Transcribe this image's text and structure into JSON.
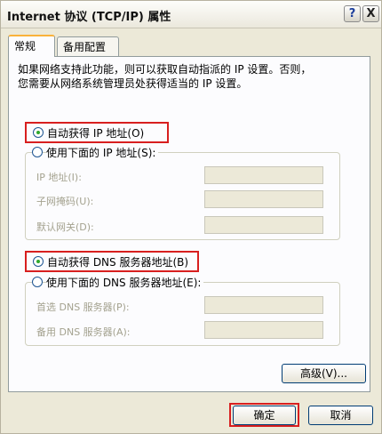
{
  "window": {
    "title": "Internet 协议 (TCP/IP) 属性",
    "help_label": "?",
    "close_label": "X"
  },
  "tabs": [
    {
      "label": "常规",
      "active": true
    },
    {
      "label": "备用配置",
      "active": false
    }
  ],
  "description_lines": [
    "如果网络支持此功能，则可以获取自动指派的 IP 设置。否则，",
    "您需要从网络系统管理员处获得适当的 IP 设置。"
  ],
  "ip": {
    "auto_label": "自动获得 IP 地址(O)",
    "manual_label": "使用下面的 IP 地址(S):",
    "selected": "auto",
    "fields": [
      {
        "label": "IP 地址(I):",
        "value": ""
      },
      {
        "label": "子网掩码(U):",
        "value": ""
      },
      {
        "label": "默认网关(D):",
        "value": ""
      }
    ]
  },
  "dns": {
    "auto_label": "自动获得 DNS 服务器地址(B)",
    "manual_label": "使用下面的 DNS 服务器地址(E):",
    "selected": "auto",
    "fields": [
      {
        "label": "首选 DNS 服务器(P):",
        "value": ""
      },
      {
        "label": "备用 DNS 服务器(A):",
        "value": ""
      }
    ]
  },
  "buttons": {
    "advanced": "高级(V)...",
    "ok": "确定",
    "cancel": "取消"
  },
  "colors": {
    "highlight_frame": "#d81f1f",
    "selected_radio_dot": "#2fa82f",
    "active_tab_accent": "#f9b23a"
  }
}
